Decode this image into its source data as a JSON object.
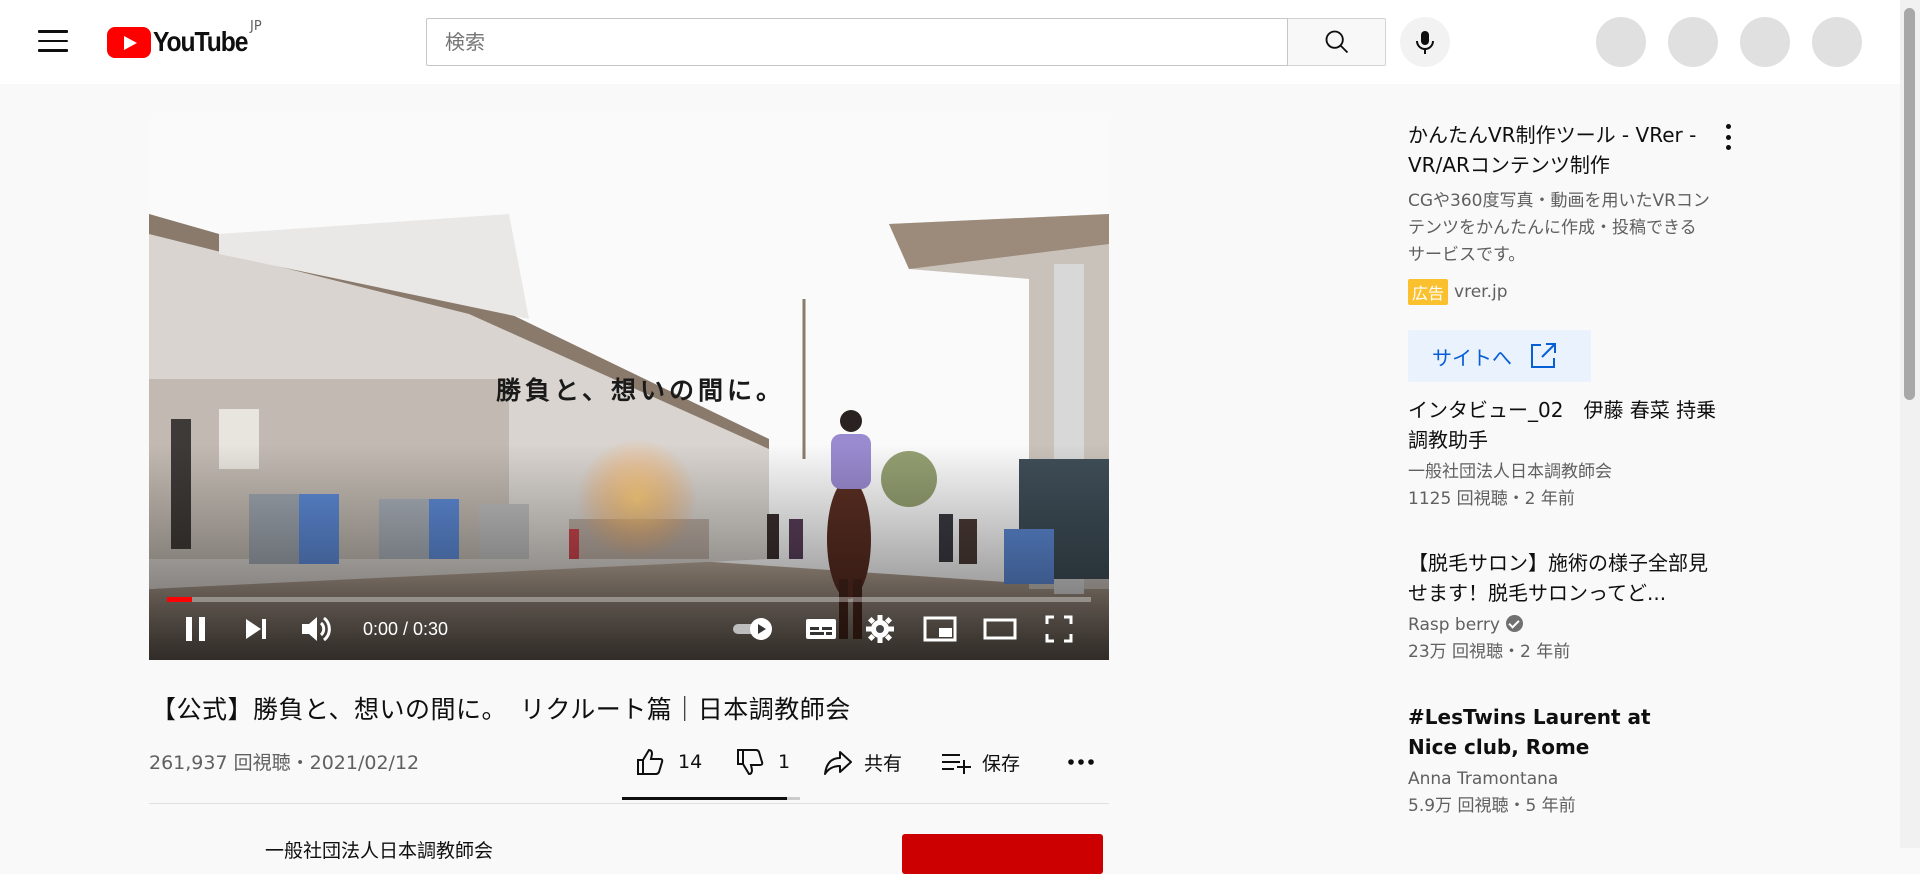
{
  "header": {
    "logo_text": "YouTube",
    "country": "JP",
    "search_placeholder": "検索"
  },
  "player": {
    "overlay_caption": "勝負と、想いの間に。",
    "time": "0:00 / 0:30",
    "progress_percent": 2.7
  },
  "video": {
    "title": "【公式】勝負と、想いの間に。　リクルート篇｜日本調教師会",
    "meta": "261,937 回視聴・2021/02/12",
    "likes": "14",
    "dislikes": "1",
    "share_label": "共有",
    "save_label": "保存",
    "channel_name": "一般社団法人日本調教師会"
  },
  "sidebar": {
    "ad": {
      "title": "かんたんVR制作ツール - VRer - VR/ARコンテンツ制作",
      "description": "CGや360度写真・動画を用いたVRコンテンツをかんたんに作成・投稿できるサービスです。",
      "badge": "広告",
      "domain": "vrer.jp",
      "button_label": "サイトへ"
    },
    "items": [
      {
        "title": "インタビュー_02　伊藤 春菜 持乗調教助手",
        "channel": "一般社団法人日本調教師会",
        "stats": "1125 回視聴・2 年前",
        "verified": false
      },
      {
        "title": "【脱毛サロン】施術の様子全部見せます！脱毛サロンってど...",
        "channel": "Rasp berry",
        "stats": "23万 回視聴・2 年前",
        "verified": true
      },
      {
        "title": "#LesTwins Laurent at Nice club, Rome",
        "channel": "Anna Tramontana",
        "stats": "5.9万 回視聴・5 年前",
        "verified": false
      }
    ]
  },
  "colors": {
    "brand_red": "#ff0000",
    "ad_badge": "#fbc02d",
    "link_blue": "#065fd4"
  }
}
